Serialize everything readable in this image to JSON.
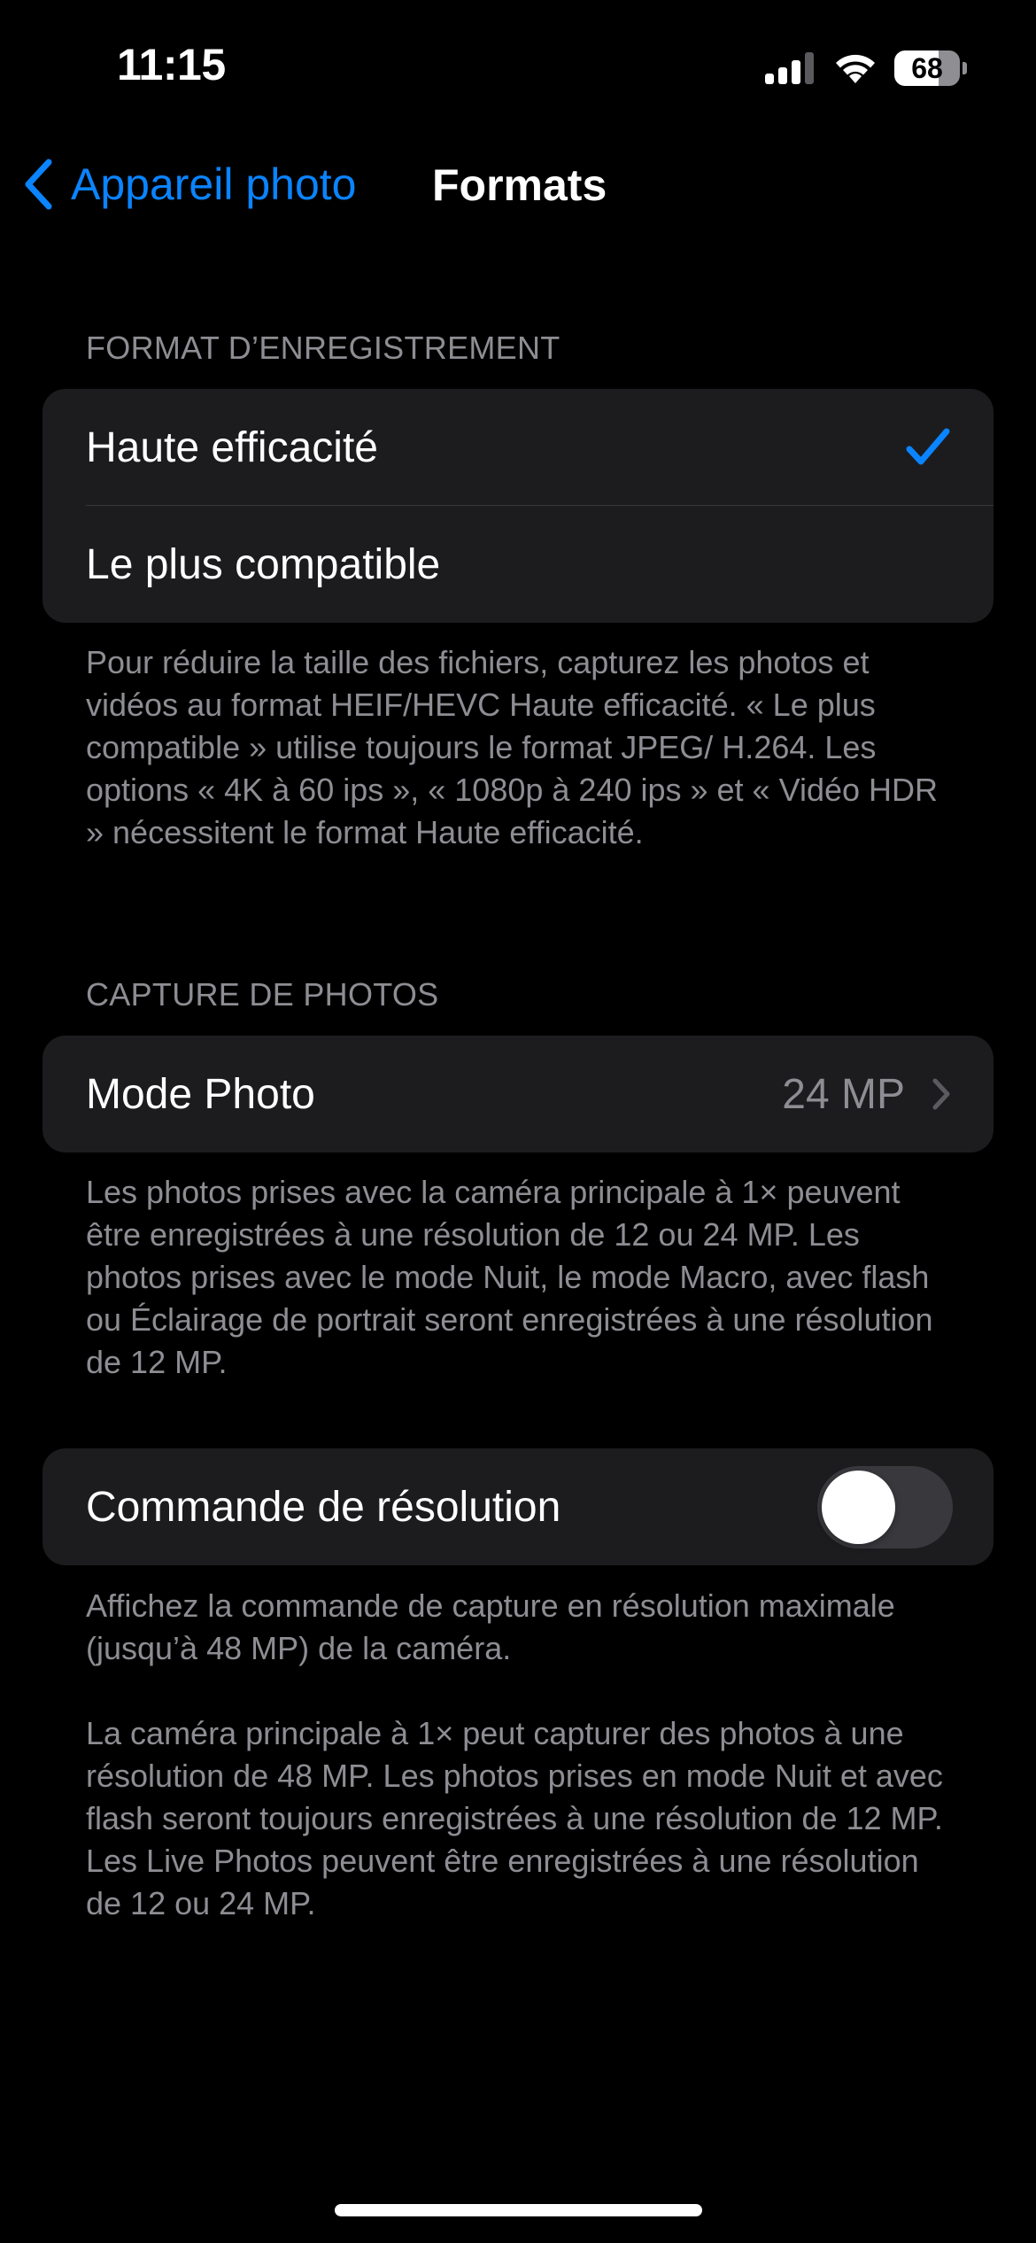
{
  "status_bar": {
    "time": "11:15",
    "battery_level": "68",
    "battery_fraction": 0.68,
    "signal_bars_active": 3,
    "signal_bars_total": 4
  },
  "nav": {
    "back_label": "Appareil photo",
    "title": "Formats"
  },
  "format_section": {
    "header": "FORMAT D’ENREGISTREMENT",
    "options": [
      {
        "label": "Haute efficacité",
        "selected": true
      },
      {
        "label": "Le plus compatible",
        "selected": false
      }
    ],
    "footer": "Pour réduire la taille des fichiers, capturez les photos et vidéos au format HEIF/HEVC Haute efficacité. « Le plus compatible » utilise toujours le format JPEG/ H.264. Les options « 4K à 60 ips », « 1080p à 240 ips » et « Vidéo HDR » nécessitent le format Haute efficacité."
  },
  "capture_section": {
    "header": "CAPTURE DE PHOTOS",
    "mode_label": "Mode Photo",
    "mode_value": "24 MP",
    "footer": "Les photos prises avec la caméra principale à 1× peuvent être enregistrées à une résolution de 12 ou 24 MP. Les photos prises avec le mode Nuit, le mode Macro, avec flash ou Éclairage de portrait seront enregistrées à une résolution de 12 MP."
  },
  "resolution_section": {
    "toggle_label": "Commande de résolution",
    "toggle_on": false,
    "footer_1": "Affichez la commande de capture en résolution maximale (jusqu’à 48 MP) de la caméra.",
    "footer_2": "La caméra principale à 1× peut capturer des photos à une résolution de 48 MP. Les photos prises en mode Nuit et avec flash seront toujours enregistrées à une résolution de 12 MP. Les Live Photos peuvent être enregistrées à une résolution de 12 ou 24 MP."
  },
  "colors": {
    "background": "#000000",
    "group_background": "#1c1c1e",
    "accent": "#0a84ff",
    "secondary_text": "#8d8d93",
    "toggle_off": "#39393d"
  }
}
